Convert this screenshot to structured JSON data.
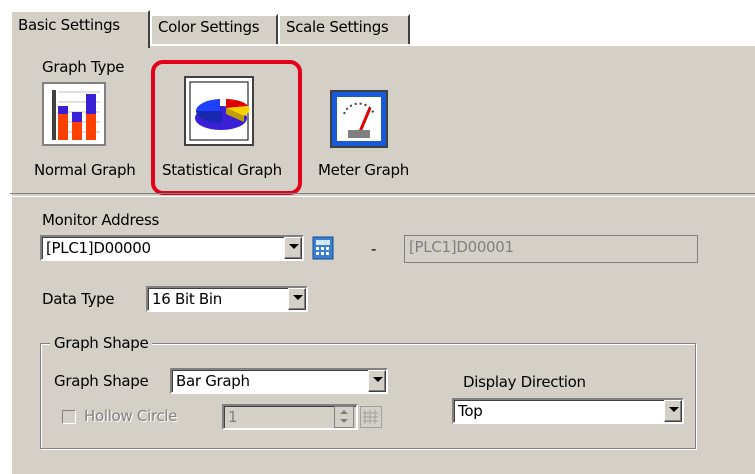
{
  "tabs": [
    {
      "label": "Basic Settings",
      "active": true
    },
    {
      "label": "Color Settings",
      "active": false
    },
    {
      "label": "Scale Settings",
      "active": false
    }
  ],
  "graph_type": {
    "label": "Graph Type",
    "options": [
      {
        "label": "Normal Graph",
        "icon": "bar-chart-icon"
      },
      {
        "label": "Statistical Graph",
        "icon": "pie-chart-icon",
        "selected": true
      },
      {
        "label": "Meter Graph",
        "icon": "meter-gauge-icon"
      }
    ]
  },
  "monitor_address": {
    "label": "Monitor Address",
    "value": "[PLC1]D00000",
    "separator": "-",
    "end_value": "[PLC1]D00001"
  },
  "data_type": {
    "label": "Data Type",
    "value": "16 Bit Bin"
  },
  "graph_shape_group": {
    "title": "Graph Shape",
    "shape_label": "Graph Shape",
    "shape_value": "Bar Graph",
    "hollow_circle_label": "Hollow Circle",
    "hollow_circle_value": "1",
    "direction_label": "Display Direction",
    "direction_value": "Top"
  },
  "colors": {
    "highlight": "#e2001a",
    "face": "#d4d0c8"
  }
}
